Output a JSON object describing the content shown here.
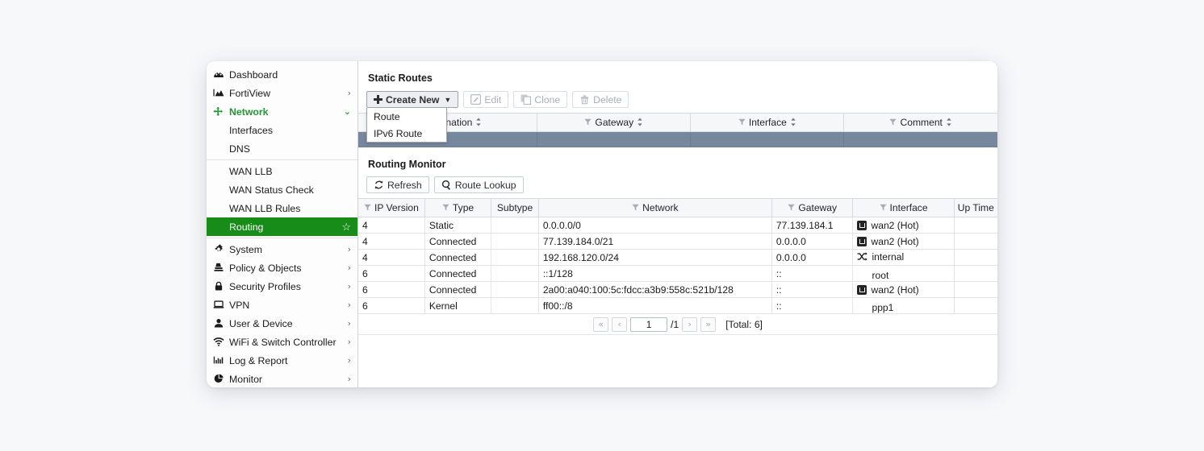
{
  "sidebar": {
    "items": [
      {
        "label": "Dashboard",
        "icon": "dashboard-gauge-icon",
        "level": 0,
        "chevron": "",
        "state": "normal"
      },
      {
        "label": "FortiView",
        "icon": "mountain-chart-icon",
        "level": 0,
        "chevron": "›",
        "state": "normal"
      },
      {
        "label": "Network",
        "icon": "network-move-icon",
        "level": 0,
        "chevron": "⌄",
        "state": "group-open"
      },
      {
        "label": "Interfaces",
        "icon": "",
        "level": 1,
        "chevron": "",
        "state": "sub"
      },
      {
        "label": "DNS",
        "icon": "",
        "level": 1,
        "chevron": "",
        "state": "sub"
      },
      {
        "label": "WAN LLB",
        "icon": "",
        "level": 1,
        "chevron": "",
        "state": "sub"
      },
      {
        "label": "WAN Status Check",
        "icon": "",
        "level": 1,
        "chevron": "",
        "state": "sub"
      },
      {
        "label": "WAN LLB Rules",
        "icon": "",
        "level": 1,
        "chevron": "",
        "state": "sub"
      },
      {
        "label": "Routing",
        "icon": "",
        "level": 1,
        "chevron": "",
        "state": "active"
      },
      {
        "label": "System",
        "icon": "gear-icon",
        "level": 0,
        "chevron": "›",
        "state": "normal"
      },
      {
        "label": "Policy & Objects",
        "icon": "policy-stamp-icon",
        "level": 0,
        "chevron": "›",
        "state": "normal"
      },
      {
        "label": "Security Profiles",
        "icon": "lock-icon",
        "level": 0,
        "chevron": "›",
        "state": "normal"
      },
      {
        "label": "VPN",
        "icon": "laptop-icon",
        "level": 0,
        "chevron": "›",
        "state": "normal"
      },
      {
        "label": "User & Device",
        "icon": "user-icon",
        "level": 0,
        "chevron": "›",
        "state": "normal"
      },
      {
        "label": "WiFi & Switch Controller",
        "icon": "wifi-icon",
        "level": 0,
        "chevron": "›",
        "state": "normal"
      },
      {
        "label": "Log & Report",
        "icon": "bar-chart-icon",
        "level": 0,
        "chevron": "›",
        "state": "normal"
      },
      {
        "label": "Monitor",
        "icon": "pie-chart-icon",
        "level": 0,
        "chevron": "›",
        "state": "normal"
      }
    ],
    "favorite_star": "☆",
    "accent_green": "#178c18",
    "group_green": "#1d9b2e"
  },
  "static_routes": {
    "title": "Static Routes",
    "toolbar": {
      "create_new": "Create New",
      "create_new_caret": "▼",
      "plus": "✛",
      "edit": "Edit",
      "clone": "Clone",
      "delete": "Delete"
    },
    "dropdown": {
      "open": true,
      "items": [
        "Route",
        "IPv6 Route"
      ]
    },
    "columns": [
      "Destination",
      "Gateway",
      "Interface",
      "Comment"
    ],
    "selected_row_color": "#77889e",
    "rows": []
  },
  "routing_monitor": {
    "title": "Routing Monitor",
    "toolbar": {
      "refresh": "Refresh",
      "refresh_icon": "↻",
      "route_lookup": "Route Lookup",
      "search_icon": "⚲"
    },
    "columns": [
      {
        "label": "IP Version",
        "filter": true
      },
      {
        "label": "Type",
        "filter": true
      },
      {
        "label": "Subtype",
        "filter": false
      },
      {
        "label": "Network",
        "filter": true
      },
      {
        "label": "Gateway",
        "filter": true
      },
      {
        "label": "Interface",
        "filter": true
      },
      {
        "label": "Up Time",
        "filter": false
      }
    ],
    "rows": [
      {
        "ip_version": "4",
        "type": "Static",
        "subtype": "",
        "network": "0.0.0.0/0",
        "gateway": "77.139.184.1",
        "interface": "wan2 (Hot)",
        "interface_icon": "port-icon",
        "up_time": ""
      },
      {
        "ip_version": "4",
        "type": "Connected",
        "subtype": "",
        "network": "77.139.184.0/21",
        "gateway": "0.0.0.0",
        "interface": "wan2 (Hot)",
        "interface_icon": "port-icon",
        "up_time": ""
      },
      {
        "ip_version": "4",
        "type": "Connected",
        "subtype": "",
        "network": "192.168.120.0/24",
        "gateway": "0.0.0.0",
        "interface": "internal",
        "interface_icon": "shuffle-icon",
        "up_time": ""
      },
      {
        "ip_version": "6",
        "type": "Connected",
        "subtype": "",
        "network": "::1/128",
        "gateway": "::",
        "interface": "root",
        "interface_icon": "none",
        "up_time": ""
      },
      {
        "ip_version": "6",
        "type": "Connected",
        "subtype": "",
        "network": "2a00:a040:100:5c:fdcc:a3b9:558c:521b/128",
        "gateway": "::",
        "interface": "wan2 (Hot)",
        "interface_icon": "port-icon",
        "up_time": ""
      },
      {
        "ip_version": "6",
        "type": "Kernel",
        "subtype": "",
        "network": "ff00::/8",
        "gateway": "::",
        "interface": "ppp1",
        "interface_icon": "none",
        "up_time": ""
      }
    ],
    "pagination": {
      "first": "«",
      "prev": "‹",
      "page_value": "1",
      "page_total": "/1",
      "next": "›",
      "last": "»",
      "total_label": "[Total: 6]"
    }
  }
}
